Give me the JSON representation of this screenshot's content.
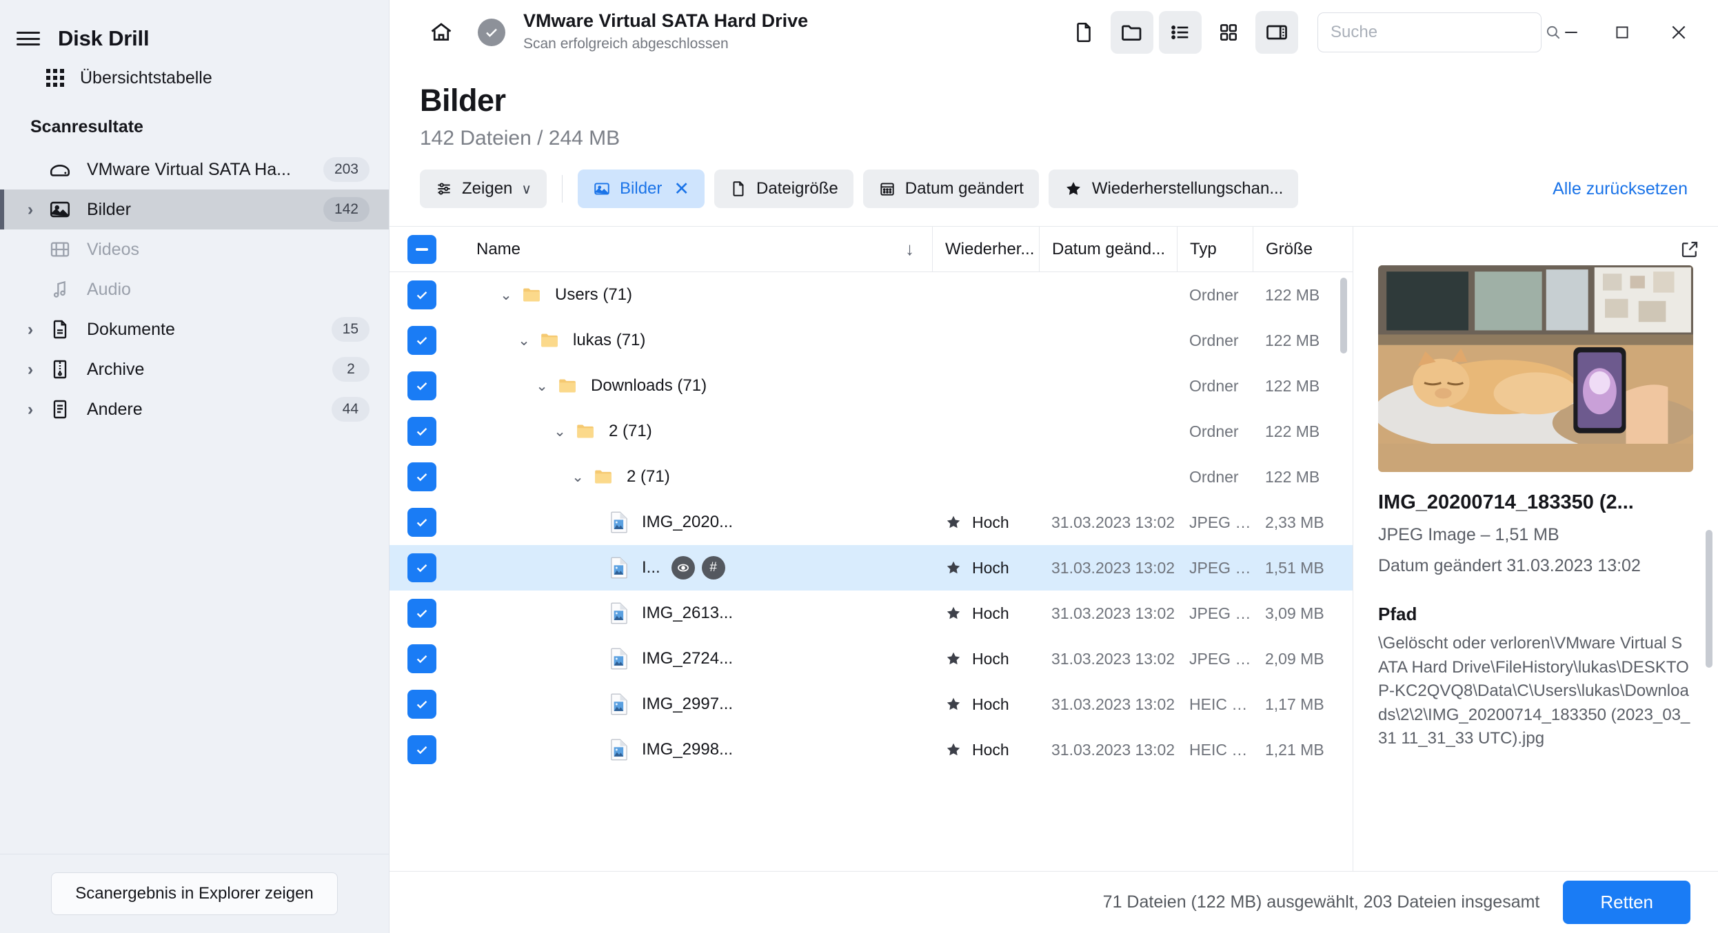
{
  "sidebar": {
    "brand": "Disk Drill",
    "menu_icon": "hamburger-icon",
    "overview": {
      "label": "Übersichtstabelle",
      "icon": "grid-dots-icon"
    },
    "group_title": "Scanresultate",
    "items": [
      {
        "label": "VMware Virtual SATA Ha...",
        "badge": "203",
        "icon": "disk-icon",
        "chevron": "",
        "dim": false,
        "selected": false
      },
      {
        "label": "Bilder",
        "badge": "142",
        "icon": "image-icon",
        "chevron": "›",
        "dim": false,
        "selected": true
      },
      {
        "label": "Videos",
        "badge": "",
        "icon": "film-icon",
        "chevron": "",
        "dim": true,
        "selected": false
      },
      {
        "label": "Audio",
        "badge": "",
        "icon": "music-icon",
        "chevron": "",
        "dim": true,
        "selected": false
      },
      {
        "label": "Dokumente",
        "badge": "15",
        "icon": "document-icon",
        "chevron": "›",
        "dim": false,
        "selected": false
      },
      {
        "label": "Archive",
        "badge": "2",
        "icon": "archive-icon",
        "chevron": "›",
        "dim": false,
        "selected": false
      },
      {
        "label": "Andere",
        "badge": "44",
        "icon": "other-file-icon",
        "chevron": "›",
        "dim": false,
        "selected": false
      }
    ],
    "explorer_button": "Scanergebnis in Explorer zeigen"
  },
  "titlebar": {
    "home_icon": "home-icon",
    "status_icon": "check-circle-icon",
    "title": "VMware Virtual SATA Hard Drive",
    "subtitle": "Scan erfolgreich abgeschlossen",
    "view_buttons": [
      {
        "name": "file-view-icon",
        "active": false
      },
      {
        "name": "folder-view-icon",
        "active": true
      },
      {
        "name": "list-view-icon",
        "active": true
      },
      {
        "name": "grid-view-icon",
        "active": false
      },
      {
        "name": "split-panel-icon",
        "active": true
      }
    ],
    "search": {
      "placeholder": "Suche",
      "value": "",
      "icon": "search-icon"
    },
    "window_controls": {
      "minimize": "minimize-icon",
      "maximize": "maximize-icon",
      "close": "close-icon"
    }
  },
  "page": {
    "title": "Bilder",
    "subtitle": "142 Dateien / 244 MB"
  },
  "filters": {
    "show_button": {
      "label": "Zeigen",
      "icon": "sliders-icon",
      "caret": "∨"
    },
    "chips": [
      {
        "label": "Bilder",
        "icon": "image-icon",
        "active": true,
        "close": "✕"
      },
      {
        "label": "Dateigröße",
        "icon": "document-icon",
        "active": false,
        "close": ""
      },
      {
        "label": "Datum geändert",
        "icon": "calendar-icon",
        "active": false,
        "close": ""
      },
      {
        "label": "Wiederherstellungschan...",
        "icon": "star-icon",
        "active": false,
        "close": ""
      }
    ],
    "reset_label": "Alle zurücksetzen"
  },
  "table": {
    "select_all_state": "indeterminate",
    "columns": [
      {
        "key": "name",
        "label": "Name",
        "sort": "↓"
      },
      {
        "key": "recovery",
        "label": "Wiederher..."
      },
      {
        "key": "date",
        "label": "Datum geänd..."
      },
      {
        "key": "type",
        "label": "Typ"
      },
      {
        "key": "size",
        "label": "Größe"
      }
    ],
    "rows": [
      {
        "checked": true,
        "indent": 0,
        "chevron": "⌄",
        "kind": "folder",
        "name": "Users (71)",
        "recovery": "",
        "star": false,
        "date": "",
        "type": "Ordner",
        "size": "122 MB",
        "selected": false,
        "actions": []
      },
      {
        "checked": true,
        "indent": 1,
        "chevron": "⌄",
        "kind": "folder",
        "name": "lukas (71)",
        "recovery": "",
        "star": false,
        "date": "",
        "type": "Ordner",
        "size": "122 MB",
        "selected": false,
        "actions": []
      },
      {
        "checked": true,
        "indent": 2,
        "chevron": "⌄",
        "kind": "folder",
        "name": "Downloads (71)",
        "recovery": "",
        "star": false,
        "date": "",
        "type": "Ordner",
        "size": "122 MB",
        "selected": false,
        "actions": []
      },
      {
        "checked": true,
        "indent": 3,
        "chevron": "⌄",
        "kind": "folder",
        "name": "2 (71)",
        "recovery": "",
        "star": false,
        "date": "",
        "type": "Ordner",
        "size": "122 MB",
        "selected": false,
        "actions": []
      },
      {
        "checked": true,
        "indent": 4,
        "chevron": "⌄",
        "kind": "folder",
        "name": "2 (71)",
        "recovery": "",
        "star": false,
        "date": "",
        "type": "Ordner",
        "size": "122 MB",
        "selected": false,
        "actions": []
      },
      {
        "checked": true,
        "indent": 5,
        "chevron": "",
        "kind": "image",
        "name": "IMG_2020...",
        "recovery": "Hoch",
        "star": true,
        "date": "31.03.2023 13:02",
        "type": "JPEG Im...",
        "size": "2,33 MB",
        "selected": false,
        "actions": []
      },
      {
        "checked": true,
        "indent": 5,
        "chevron": "",
        "kind": "image",
        "name": "I...",
        "recovery": "Hoch",
        "star": true,
        "date": "31.03.2023 13:02",
        "type": "JPEG Im...",
        "size": "1,51 MB",
        "selected": true,
        "actions": [
          "preview-eye-icon",
          "hash-icon"
        ]
      },
      {
        "checked": true,
        "indent": 5,
        "chevron": "",
        "kind": "image",
        "name": "IMG_2613...",
        "recovery": "Hoch",
        "star": true,
        "date": "31.03.2023 13:02",
        "type": "JPEG Im...",
        "size": "3,09 MB",
        "selected": false,
        "actions": []
      },
      {
        "checked": true,
        "indent": 5,
        "chevron": "",
        "kind": "image",
        "name": "IMG_2724...",
        "recovery": "Hoch",
        "star": true,
        "date": "31.03.2023 13:02",
        "type": "JPEG Im...",
        "size": "2,09 MB",
        "selected": false,
        "actions": []
      },
      {
        "checked": true,
        "indent": 5,
        "chevron": "",
        "kind": "image",
        "name": "IMG_2997...",
        "recovery": "Hoch",
        "star": true,
        "date": "31.03.2023 13:02",
        "type": "HEIC D...",
        "size": "1,17 MB",
        "selected": false,
        "actions": []
      },
      {
        "checked": true,
        "indent": 5,
        "chevron": "",
        "kind": "image",
        "name": "IMG_2998...",
        "recovery": "Hoch",
        "star": true,
        "date": "31.03.2023 13:02",
        "type": "HEIC D...",
        "size": "1,21 MB",
        "selected": false,
        "actions": []
      }
    ]
  },
  "preview": {
    "expand_icon": "open-external-icon",
    "thumbnail_alt": "cat-sleeping-photo",
    "title": "IMG_20200714_183350 (2...",
    "meta_type": "JPEG Image – 1,51 MB",
    "meta_date": "Datum geändert 31.03.2023 13:02",
    "path_heading": "Pfad",
    "path_value": "\\Gelöscht oder verloren\\VMware Virtual SATA Hard Drive\\FileHistory\\lukas\\DESKTOP-KC2QVQ8\\Data\\C\\Users\\lukas\\Downloads\\2\\2\\IMG_20200714_183350 (2023_03_31 11_31_33 UTC).jpg"
  },
  "statusbar": {
    "summary": "71 Dateien (122 MB) ausgewählt, 203 Dateien insgesamt",
    "save_label": "Retten"
  },
  "colors": {
    "accent_blue": "#1a7cf5",
    "link_blue": "#1a73e8",
    "chip_active_bg": "#cfe4fd",
    "sidebar_bg": "#eef1f6",
    "selected_row": "#d9ecfd"
  }
}
